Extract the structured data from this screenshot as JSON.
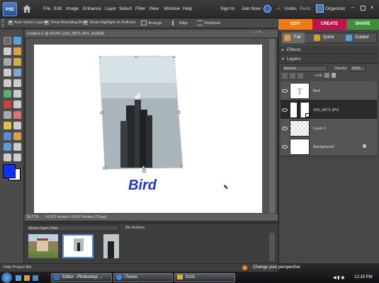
{
  "app": {
    "logo": "PSE",
    "title_doc": "Untitled-1 @ 59.8% (100_0873.JPG, RGB/8)"
  },
  "menu": {
    "items": [
      "File",
      "Edit",
      "Image",
      "Enhance",
      "Layer",
      "Select",
      "Filter",
      "View",
      "Window",
      "Help"
    ],
    "sign_in": "Sign In",
    "join_now": "Join Now",
    "undo": "Undo",
    "redo": "Redo",
    "organizer": "Organizer"
  },
  "options": {
    "auto_select": "Auto Select Layer",
    "bounding_box": "Show Bounding Box",
    "highlight": "Show Highlight on Rollover",
    "arrange": "Arrange",
    "align": "Align",
    "distribute": "Distribute"
  },
  "modes": {
    "edit": "EDIT",
    "create": "CREATE",
    "share": "SHARE",
    "full": "Full",
    "quick": "Quick",
    "guided": "Guided"
  },
  "colors": {
    "edit": "#f07a14",
    "create": "#c0134f",
    "share": "#3f8f3c",
    "foreground": "#1030ff"
  },
  "canvas": {
    "text": "Bird",
    "text_color": "#2233cc"
  },
  "status": {
    "zoom": "59.77%",
    "size": "14.222 inches x 10.667 inches (72 ppi)"
  },
  "bin": {
    "show_open_files": "Show Open Files",
    "bin_actions": "Bin Actions",
    "hide_bin": "Hide Project Bin",
    "thumb_count": 3
  },
  "panels": {
    "effects": "Effects",
    "layers": "Layers",
    "blend": "Normal",
    "opacity_label": "Opacity:",
    "opacity": "100%",
    "lock": "Lock:"
  },
  "layers": [
    {
      "name": "Bird",
      "type": "text",
      "glyph": "T"
    },
    {
      "name": "100_0873.JPG",
      "type": "image",
      "selected": true
    },
    {
      "name": "Layer 1",
      "type": "transparent"
    },
    {
      "name": "Background",
      "type": "white",
      "italic": true
    }
  ],
  "taskbar": {
    "tasks": [
      "Editor - Photoshop ...",
      "iTunes",
      "0101"
    ],
    "hint": "Change your perspective",
    "clock": "12:29 PM"
  }
}
